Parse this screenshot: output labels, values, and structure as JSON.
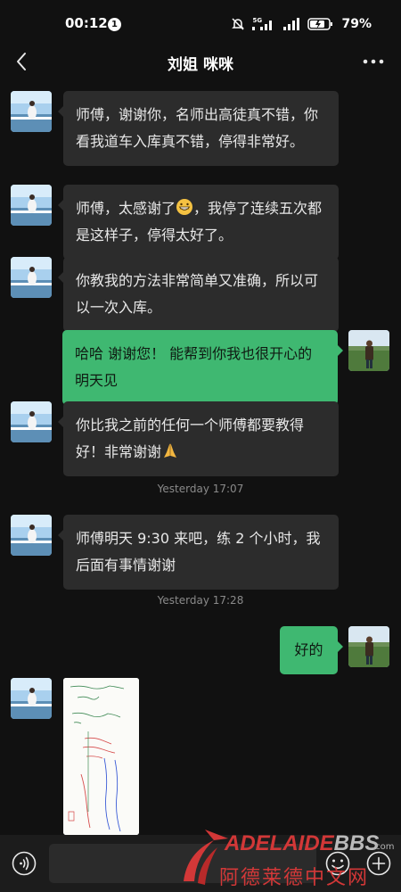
{
  "status": {
    "time": "00:12",
    "notification_count": "1",
    "signal_label": "5G",
    "battery": "79%"
  },
  "header": {
    "title": "刘姐 咪咪"
  },
  "messages": [
    {
      "from": "contact",
      "text": "师傅，谢谢你，名师出高徒真不错，你看我道车入库真不错，停得非常好。"
    },
    {
      "from": "contact",
      "text_before": "师傅，太感谢了",
      "emoji": "grinning-face",
      "text_after": "，我停了连续五次都是这样子，停得太好了。"
    },
    {
      "from": "contact",
      "text": "你教我的方法非常简单又准确，所以可以一次入库。"
    },
    {
      "from": "me",
      "text": "哈哈 谢谢您！ 能帮到你我也很开心的 明天见"
    },
    {
      "from": "contact",
      "text_before": "你比我之前的任何一个师傅都要教得好！非常谢谢",
      "emoji": "folded-hands"
    },
    {
      "from": "contact",
      "text": "师傅明天 9:30 来吧，练 2 个小时，我后面有事情谢谢"
    },
    {
      "from": "me",
      "text": "好的"
    },
    {
      "from": "contact",
      "type": "image",
      "image": "handwritten-notes-photo"
    }
  ],
  "timestamps": [
    "Yesterday 17:07",
    "Yesterday 17:28"
  ],
  "input": {
    "value": "",
    "placeholder": ""
  },
  "watermark": {
    "brand_en": "ADELAIDE",
    "brand_bbs": "BBS",
    "brand_com": ".com",
    "brand_cn": "阿德莱德中文网"
  },
  "colors": {
    "background": "#111111",
    "bubble_incoming": "#2c2c2c",
    "bubble_outgoing": "#3fb871",
    "input_bar": "#1c1c1c",
    "watermark_red": "#e23a3a"
  },
  "icons": [
    "back-arrow",
    "more-dots",
    "voice",
    "emoji",
    "plus"
  ]
}
